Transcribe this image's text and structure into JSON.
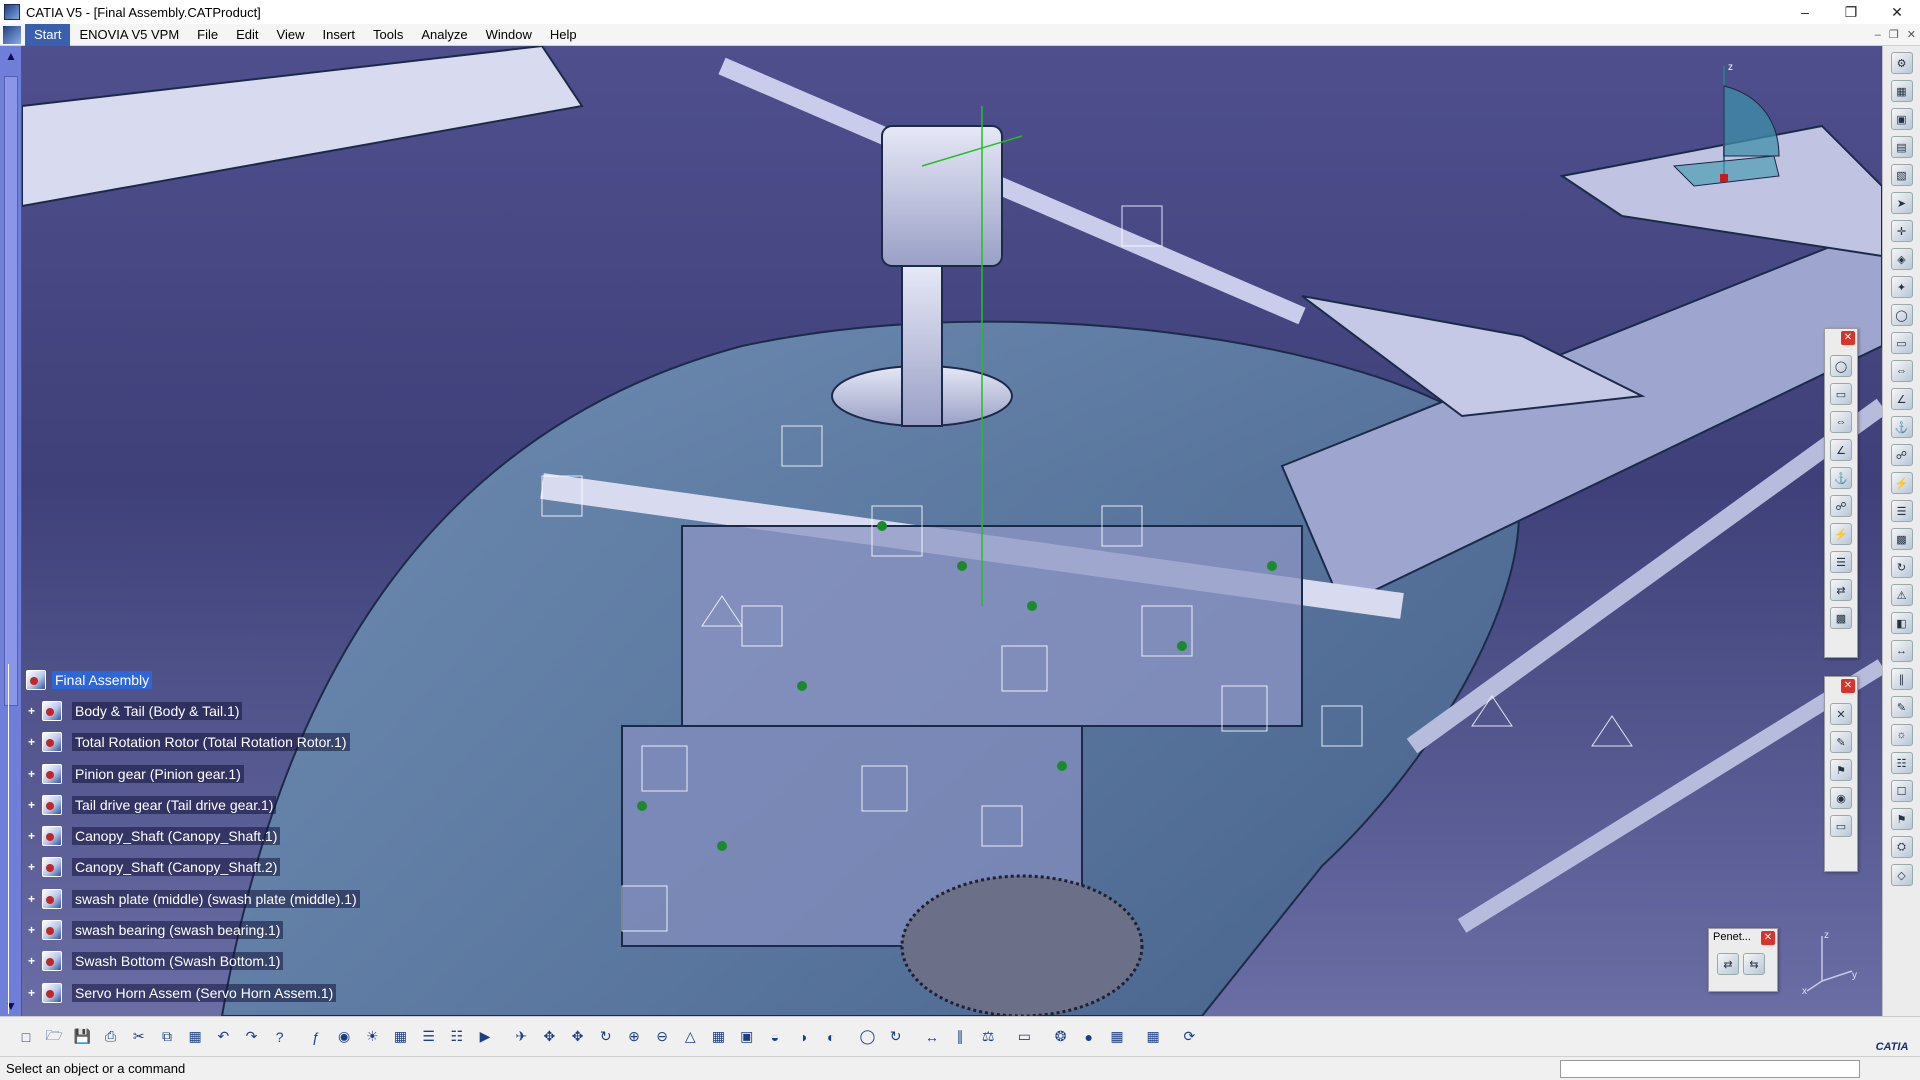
{
  "window": {
    "title": "CATIA V5 - [Final Assembly.CATProduct]"
  },
  "menu": {
    "items": [
      "Start",
      "ENOVIA V5 VPM",
      "File",
      "Edit",
      "View",
      "Insert",
      "Tools",
      "Analyze",
      "Window",
      "Help"
    ],
    "active_index": 0
  },
  "tree": {
    "root": "Final Assembly",
    "items": [
      "Body & Tail (Body & Tail.1)",
      "Total Rotation Rotor (Total Rotation Rotor.1)",
      "Pinion gear (Pinion gear.1)",
      "Tail drive gear (Tail drive gear.1)",
      "Canopy_Shaft (Canopy_Shaft.1)",
      "Canopy_Shaft (Canopy_Shaft.2)",
      "swash plate (middle) (swash plate (middle).1)",
      "swash bearing (swash bearing.1)",
      "Swash Bottom (Swash Bottom.1)",
      "Servo Horn Assem (Servo Horn Assem.1)"
    ]
  },
  "floating_toolbars": {
    "penetration_title": "Penet..."
  },
  "compass": {
    "z_label": "z",
    "y_label": "y",
    "x_label": "x"
  },
  "status": {
    "message": "Select an object or a command",
    "logo": "CATIA"
  },
  "colors": {
    "viewport_bg": "#3f4079",
    "tree_highlight": "#2d66d8",
    "scroll": "#6f7fd9"
  }
}
